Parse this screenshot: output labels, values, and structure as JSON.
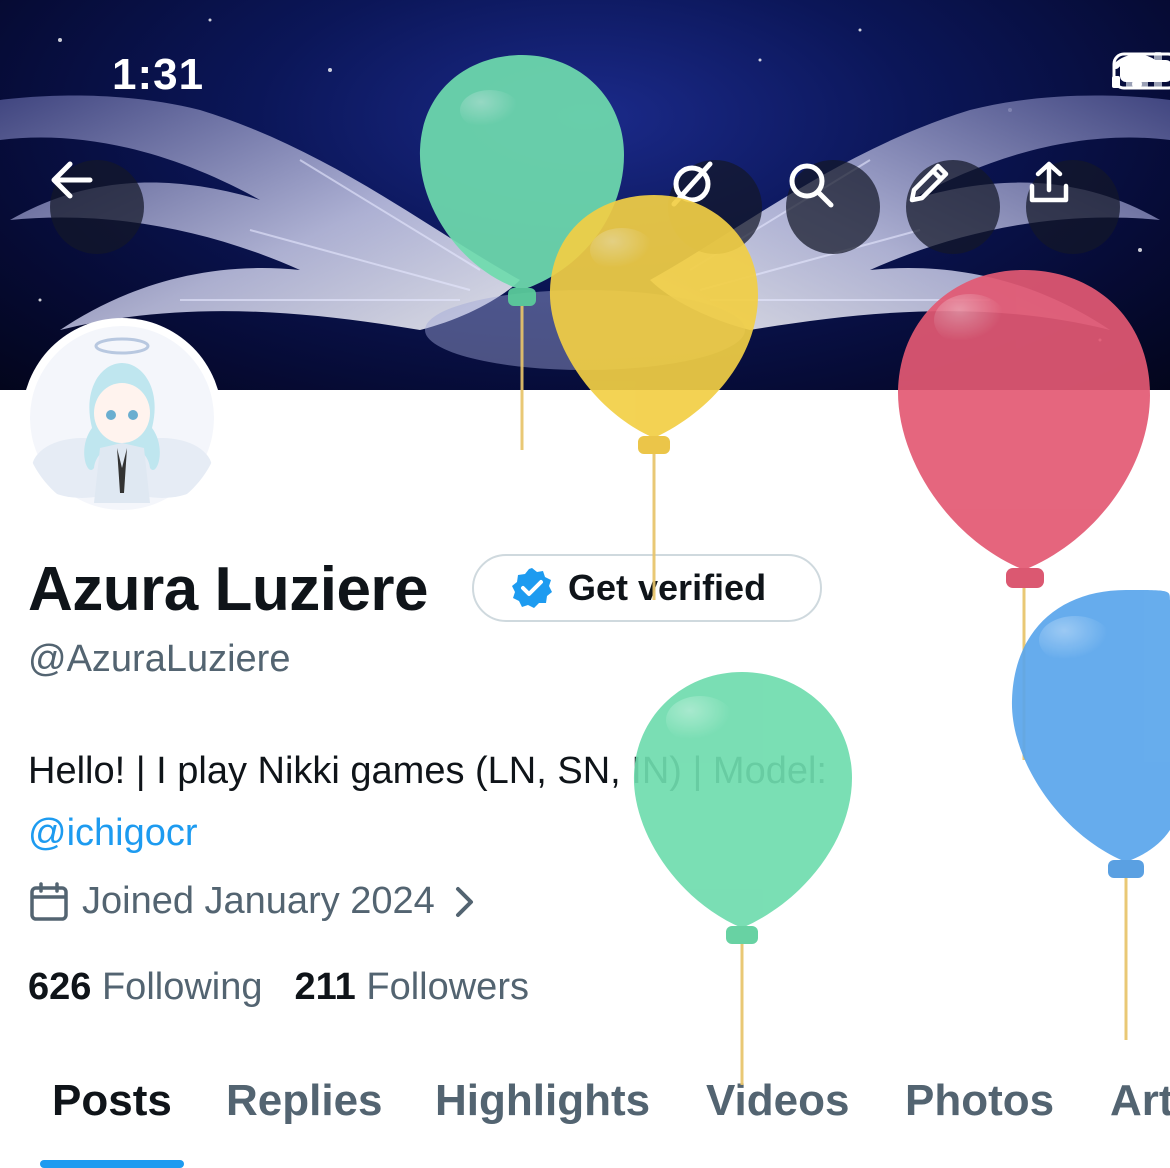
{
  "status_bar": {
    "time": "1:31"
  },
  "header": {
    "back_icon": "back-arrow-icon",
    "actions": [
      "grok-icon",
      "search-icon",
      "edit-pencil-icon",
      "share-icon"
    ]
  },
  "profile": {
    "display_name": "Azura Luziere",
    "verify_label": "Get verified",
    "handle": "@AzuraLuziere",
    "bio_text": "Hello! | I play Nikki games (LN, SN, IN) | Model:",
    "bio_mention": "@ichigocr",
    "joined": "Joined January 2024",
    "following_count": "626",
    "following_label": "Following",
    "followers_count": "211",
    "followers_label": "Followers"
  },
  "tabs": [
    {
      "label": "Posts",
      "active": true
    },
    {
      "label": "Replies"
    },
    {
      "label": "Highlights"
    },
    {
      "label": "Videos"
    },
    {
      "label": "Photos"
    },
    {
      "label": "Art"
    }
  ],
  "colors": {
    "accent": "#1d9bf0",
    "text": "#0f1419",
    "muted": "#536471"
  }
}
